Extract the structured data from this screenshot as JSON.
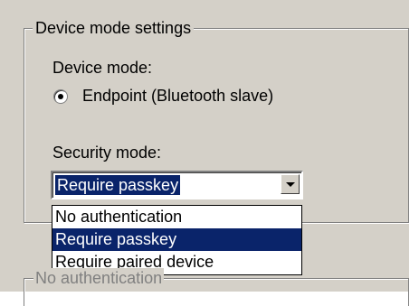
{
  "group": {
    "title": "Device mode settings"
  },
  "device_mode": {
    "label": "Device mode:",
    "selected_option": "Endpoint (Bluetooth slave)"
  },
  "security_mode": {
    "label": "Security mode:",
    "selected_value": "Require passkey",
    "options": [
      "No authentication",
      "Require passkey",
      "Require paired device"
    ],
    "highlighted_option": "Require passkey"
  },
  "lower_group": {
    "title": "No authentication"
  },
  "colors": {
    "panel": "#d4d0c8",
    "selection": "#0a246a",
    "selection_text": "#ffffff"
  }
}
